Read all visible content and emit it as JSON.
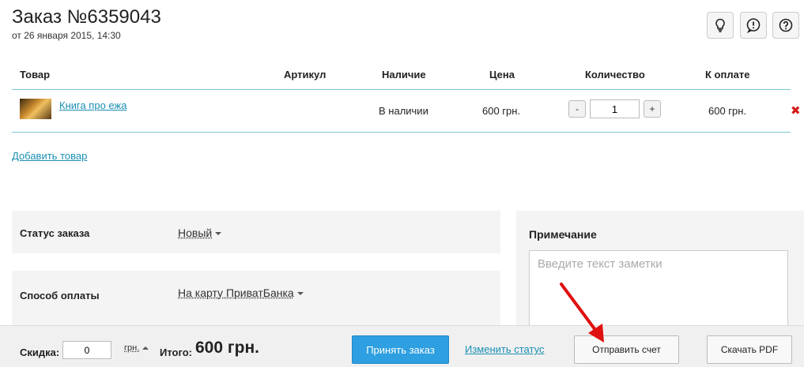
{
  "header": {
    "title": "Заказ №6359043",
    "subtitle": "от 26 января 2015, 14:30",
    "icons": [
      "lightbulb-icon",
      "exclamation-icon",
      "question-icon"
    ]
  },
  "table": {
    "headers": {
      "product": "Товар",
      "sku": "Артикул",
      "availability": "Наличие",
      "price": "Цена",
      "quantity": "Количество",
      "to_pay": "К оплате"
    },
    "rows": [
      {
        "product": "Книга про ежа",
        "sku": "",
        "availability": "В наличии",
        "price": "600 грн.",
        "quantity": "1",
        "minus": "-",
        "plus": "+",
        "to_pay": "600 грн."
      }
    ],
    "delete_glyph": "✖"
  },
  "add_product_label": "Добавить товар",
  "order_status": {
    "label": "Статус заказа",
    "value": "Новый"
  },
  "payment_method": {
    "label": "Способ оплаты",
    "value": "На карту ПриватБанка"
  },
  "note": {
    "title": "Примечание",
    "placeholder": "Введите текст заметки"
  },
  "bottom_bar": {
    "discount_label": "Скидка:",
    "discount_value": "0",
    "currency": "грн.",
    "total_label": "Итого:",
    "total_value": "600 грн.",
    "accept_order": "Принять заказ",
    "change_status": "Изменить статус",
    "send_invoice": "Отправить счет",
    "download_pdf": "Скачать PDF"
  },
  "colors": {
    "accent": "#2e9fe0",
    "link": "#1a8fb3",
    "divider": "#7fc7d3",
    "delete": "#d61a1a",
    "annotation_arrow": "#e01010"
  }
}
